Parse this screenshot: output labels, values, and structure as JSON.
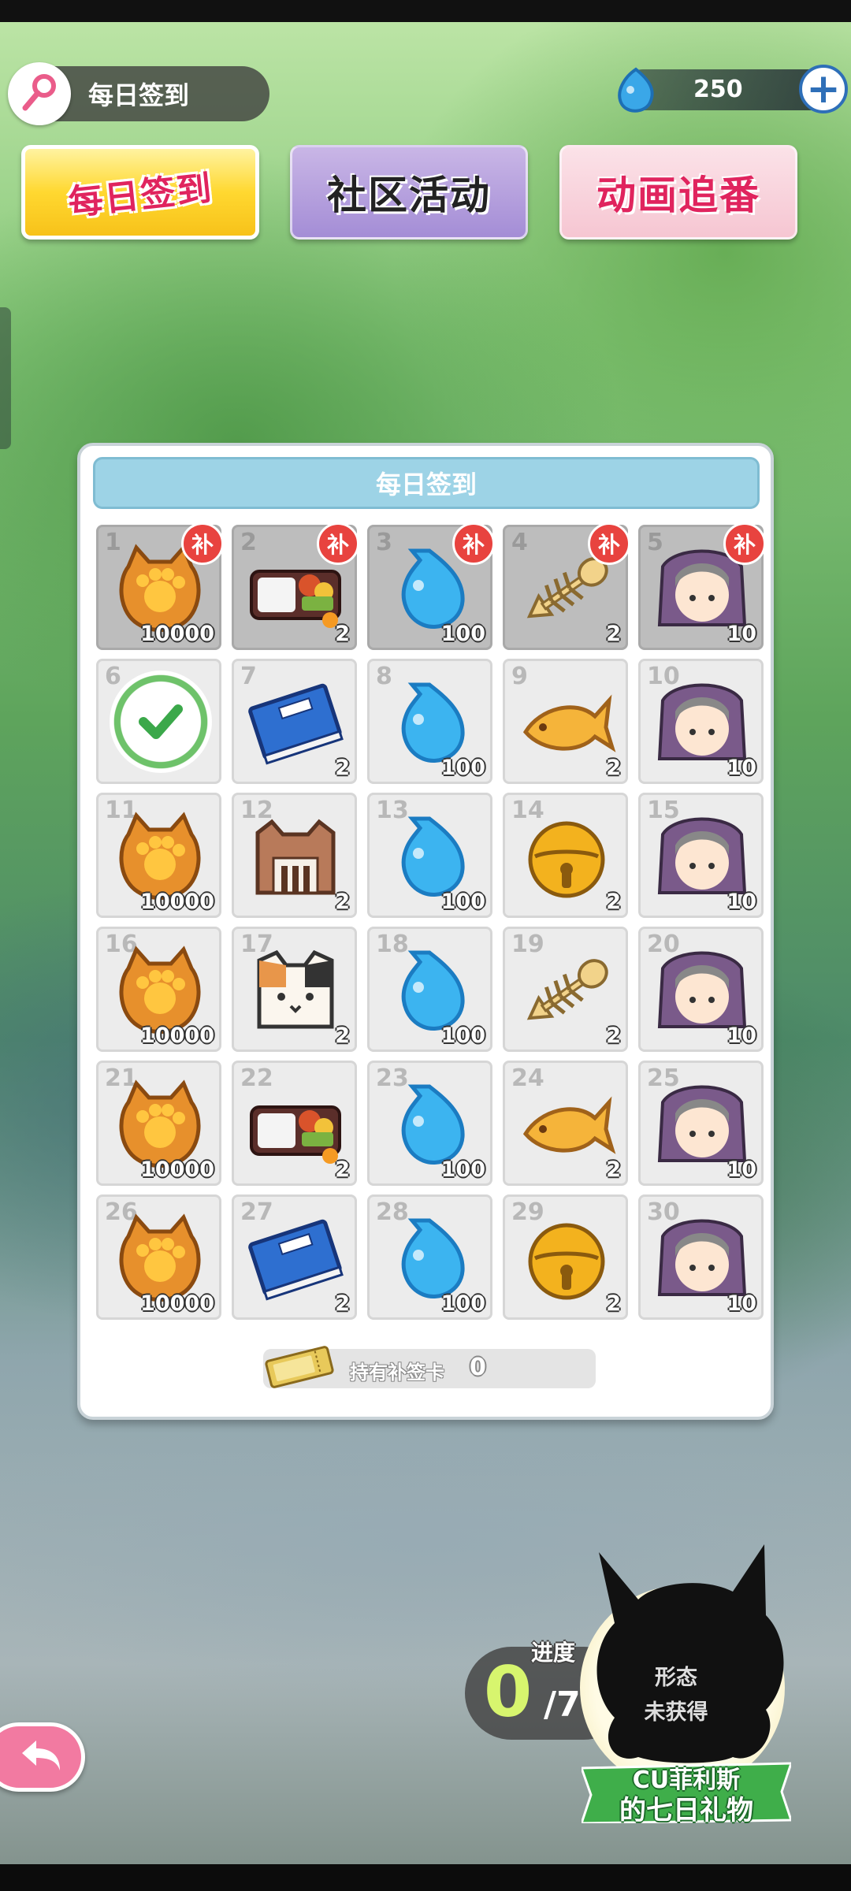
{
  "header": {
    "title": "每日签到",
    "currency_amount": "250",
    "currency_icon": "fish-drop-icon",
    "plus_label": "+"
  },
  "tabs": [
    {
      "label": "每日签到",
      "active": true
    },
    {
      "label": "社区活动",
      "active": false
    },
    {
      "label": "动画追番",
      "active": false
    }
  ],
  "panel": {
    "title": "每日签到",
    "days": [
      {
        "day": "1",
        "item": "paw-coin-icon",
        "qty": "10000",
        "state": "missed",
        "badge": "补"
      },
      {
        "day": "2",
        "item": "bento-box-icon",
        "qty": "2",
        "state": "missed",
        "badge": "补"
      },
      {
        "day": "3",
        "item": "blue-fish-drop-icon",
        "qty": "100",
        "state": "missed",
        "badge": "补"
      },
      {
        "day": "4",
        "item": "fish-bone-icon",
        "qty": "2",
        "state": "missed",
        "badge": "补"
      },
      {
        "day": "5",
        "item": "character-avatar-icon",
        "qty": "10",
        "state": "missed",
        "badge": "补"
      },
      {
        "day": "6",
        "item": "check-icon",
        "qty": "",
        "state": "claimed",
        "badge": ""
      },
      {
        "day": "7",
        "item": "blue-book-icon",
        "qty": "2",
        "state": "locked",
        "badge": ""
      },
      {
        "day": "8",
        "item": "blue-fish-drop-icon",
        "qty": "100",
        "state": "locked",
        "badge": ""
      },
      {
        "day": "9",
        "item": "golden-fish-icon",
        "qty": "2",
        "state": "locked",
        "badge": ""
      },
      {
        "day": "10",
        "item": "character-avatar-icon",
        "qty": "10",
        "state": "locked",
        "badge": ""
      },
      {
        "day": "11",
        "item": "paw-coin-icon",
        "qty": "10000",
        "state": "locked",
        "badge": ""
      },
      {
        "day": "12",
        "item": "cat-box-icon",
        "qty": "2",
        "state": "locked",
        "badge": ""
      },
      {
        "day": "13",
        "item": "blue-fish-drop-icon",
        "qty": "100",
        "state": "locked",
        "badge": ""
      },
      {
        "day": "14",
        "item": "golden-bell-icon",
        "qty": "2",
        "state": "locked",
        "badge": ""
      },
      {
        "day": "15",
        "item": "character-avatar-icon",
        "qty": "10",
        "state": "locked",
        "badge": ""
      },
      {
        "day": "16",
        "item": "paw-coin-icon",
        "qty": "10000",
        "state": "locked",
        "badge": ""
      },
      {
        "day": "17",
        "item": "cat-cube-icon",
        "qty": "2",
        "state": "locked",
        "badge": ""
      },
      {
        "day": "18",
        "item": "blue-fish-drop-icon",
        "qty": "100",
        "state": "locked",
        "badge": ""
      },
      {
        "day": "19",
        "item": "fish-bone-icon",
        "qty": "2",
        "state": "locked",
        "badge": ""
      },
      {
        "day": "20",
        "item": "character-avatar-icon",
        "qty": "10",
        "state": "locked",
        "badge": ""
      },
      {
        "day": "21",
        "item": "paw-coin-icon",
        "qty": "10000",
        "state": "locked",
        "badge": ""
      },
      {
        "day": "22",
        "item": "bento-box-icon",
        "qty": "2",
        "state": "locked",
        "badge": ""
      },
      {
        "day": "23",
        "item": "blue-fish-drop-icon",
        "qty": "100",
        "state": "locked",
        "badge": ""
      },
      {
        "day": "24",
        "item": "golden-fish-icon",
        "qty": "2",
        "state": "locked",
        "badge": ""
      },
      {
        "day": "25",
        "item": "character-avatar-icon",
        "qty": "10",
        "state": "locked",
        "badge": ""
      },
      {
        "day": "26",
        "item": "paw-coin-icon",
        "qty": "10000",
        "state": "locked",
        "badge": ""
      },
      {
        "day": "27",
        "item": "blue-book-icon",
        "qty": "2",
        "state": "locked",
        "badge": ""
      },
      {
        "day": "28",
        "item": "blue-fish-drop-icon",
        "qty": "100",
        "state": "locked",
        "badge": ""
      },
      {
        "day": "29",
        "item": "golden-bell-icon",
        "qty": "2",
        "state": "locked",
        "badge": ""
      },
      {
        "day": "30",
        "item": "character-avatar-icon",
        "qty": "10",
        "state": "locked",
        "badge": ""
      }
    ],
    "makeup_label": "持有补签卡",
    "makeup_count": "0"
  },
  "progress": {
    "label": "进度",
    "current": "0",
    "total": "/7",
    "form_line1": "形态",
    "form_line2": "未获得",
    "gift_line1": "CU菲利斯",
    "gift_line2": "的七日礼物"
  },
  "colors": {
    "missed_badge": "#e8433f",
    "header_bar": "#9dd3e6",
    "progress_current": "#d7f56e",
    "back_button": "#f27aa1"
  }
}
